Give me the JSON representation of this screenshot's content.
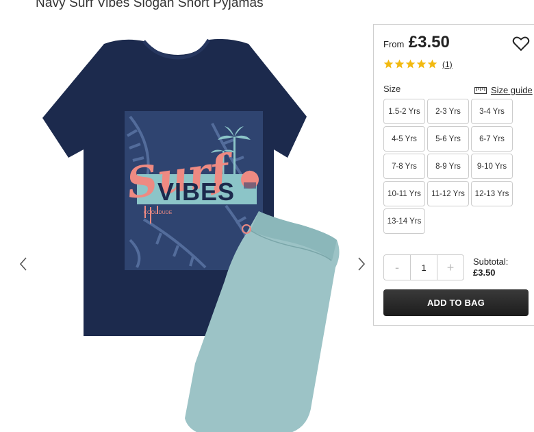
{
  "product": {
    "title": "Navy Surf Vibes Slogan Short Pyjamas"
  },
  "artwork": {
    "line1": "Surf",
    "line2": "VIBES",
    "small_text": "COOL DUDE"
  },
  "pricing": {
    "from_label": "From",
    "price": "£3.50"
  },
  "rating": {
    "stars": 5,
    "count_text": "(1)",
    "star_color": "#f2b90f"
  },
  "size": {
    "label": "Size",
    "guide_label": "Size guide",
    "options": [
      "1.5-2 Yrs",
      "2-3 Yrs",
      "3-4 Yrs",
      "4-5 Yrs",
      "5-6 Yrs",
      "6-7 Yrs",
      "7-8 Yrs",
      "8-9 Yrs",
      "9-10 Yrs",
      "10-11 Yrs",
      "11-12 Yrs",
      "12-13 Yrs",
      "13-14 Yrs"
    ]
  },
  "quantity": {
    "minus": "-",
    "value": "1",
    "plus": "+"
  },
  "subtotal": {
    "label": "Subtotal:",
    "amount": "£3.50"
  },
  "cart": {
    "add_label": "ADD TO BAG"
  },
  "colors": {
    "tshirt": "#1c2a4d",
    "shorts": "#9cc3c6",
    "accent_pink": "#ee8a82",
    "button": "#222222"
  }
}
